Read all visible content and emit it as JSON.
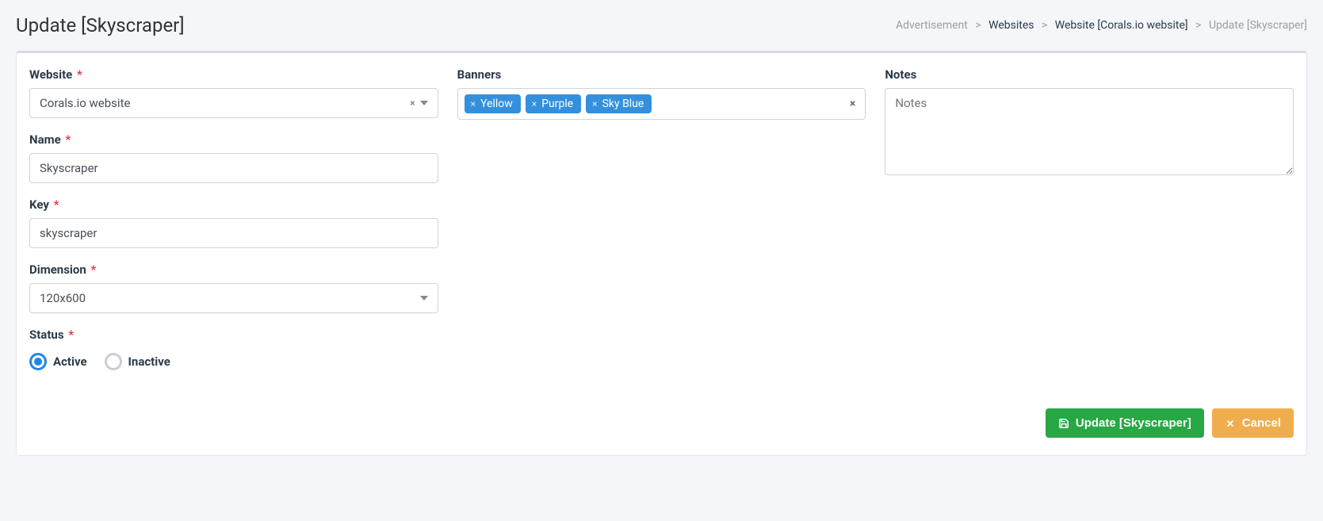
{
  "header": {
    "title": "Update [Skyscraper]"
  },
  "breadcrumb": {
    "items": [
      {
        "label": "Advertisement",
        "muted": true
      },
      {
        "label": "Websites",
        "muted": false
      },
      {
        "label": "Website [Corals.io website]",
        "muted": false
      },
      {
        "label": "Update [Skyscraper]",
        "muted": true
      }
    ],
    "sep": ">"
  },
  "form": {
    "website": {
      "label": "Website",
      "value": "Corals.io website"
    },
    "name": {
      "label": "Name",
      "value": "Skyscraper"
    },
    "key": {
      "label": "Key",
      "value": "skyscraper"
    },
    "dimension": {
      "label": "Dimension",
      "value": "120x600"
    },
    "status": {
      "label": "Status",
      "options": [
        {
          "label": "Active",
          "checked": true
        },
        {
          "label": "Inactive",
          "checked": false
        }
      ]
    },
    "banners": {
      "label": "Banners",
      "tags": [
        "Yellow",
        "Purple",
        "Sky Blue"
      ]
    },
    "notes": {
      "label": "Notes",
      "placeholder": "Notes",
      "value": ""
    }
  },
  "actions": {
    "submit": "Update [Skyscraper]",
    "cancel": "Cancel"
  }
}
